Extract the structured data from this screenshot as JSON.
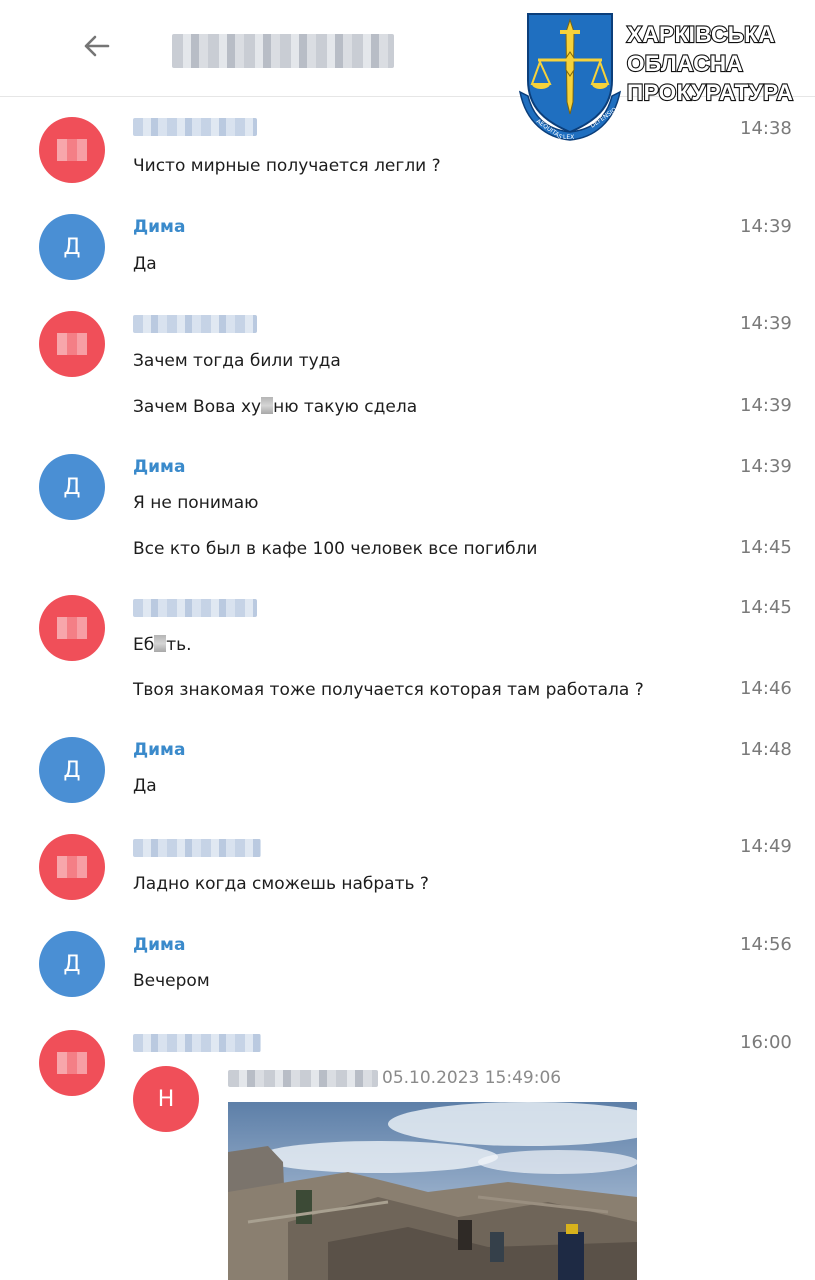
{
  "header": {
    "back_icon": "arrow-left-icon"
  },
  "watermark": {
    "org_lines": [
      "ХАРКІВСЬКА",
      "ОБЛАСНА",
      "ПРОКУРАТУРА"
    ],
    "crest_text": [
      "AEQUITAS",
      "LEX",
      "DEFENSIO"
    ]
  },
  "colors": {
    "sender_blue": "#3a8acb",
    "avatar_red": "#f04f59",
    "avatar_blue": "#4a8fd4"
  },
  "messages": [
    {
      "time": "14:38",
      "text": "Чисто мирные получается легли ?"
    },
    {
      "sender": "Дима",
      "avatar": "Д",
      "time": "14:39",
      "text": "Да"
    },
    {
      "time": "14:39",
      "text": "Зачем тогда били туда"
    },
    {
      "time": "14:39",
      "text_a": "Зачем Вова ху",
      "text_b": "ню такую сдела"
    },
    {
      "sender": "Дима",
      "avatar": "Д",
      "time": "14:39",
      "text": "Я не понимаю"
    },
    {
      "time": "14:45",
      "text": "Все кто был в кафе 100 человек все погибли"
    },
    {
      "time": "14:45",
      "text_a": "Еб",
      "text_b": "ть."
    },
    {
      "time": "14:46",
      "text": "Твоя знакомая тоже получается которая там работала ?"
    },
    {
      "sender": "Дима",
      "avatar": "Д",
      "time": "14:48",
      "text": "Да"
    },
    {
      "time": "14:49",
      "text": "Ладно когда сможешь набрать ?"
    },
    {
      "sender": "Дима",
      "avatar": "Д",
      "time": "14:56",
      "text": "Вечером"
    },
    {
      "time": "16:00"
    }
  ],
  "forwarded": {
    "avatar": "Н",
    "date": "05.10.2023 15:49:06"
  }
}
